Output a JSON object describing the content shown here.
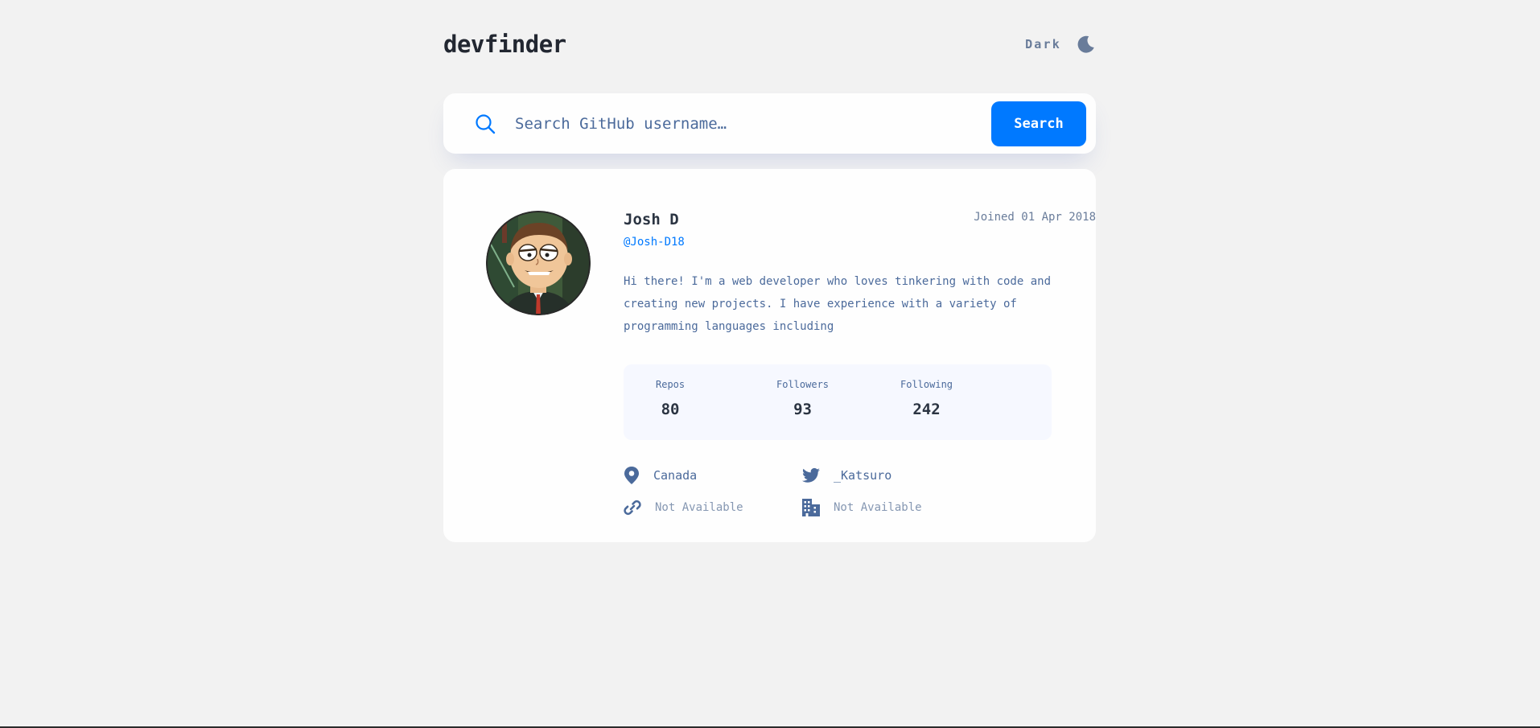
{
  "header": {
    "logo": "devfinder",
    "theme_label": "Dark",
    "theme_icon": "moon-icon"
  },
  "search": {
    "placeholder": "Search GitHub username…",
    "value": "",
    "button_label": "Search",
    "icon": "search-icon"
  },
  "profile": {
    "name": "Josh D",
    "login": "@Josh-D18",
    "joined": "Joined 01 Apr 2018",
    "bio": "Hi there! I'm a web developer who loves tinkering with code and creating new projects. I have experience with a variety of programming languages including",
    "stats": [
      {
        "label": "Repos",
        "value": "80"
      },
      {
        "label": "Followers",
        "value": "93"
      },
      {
        "label": "Following",
        "value": "242"
      }
    ],
    "links": {
      "location": {
        "icon": "location-pin-icon",
        "text": "Canada"
      },
      "twitter": {
        "icon": "twitter-icon",
        "text": "_Katsuro"
      },
      "website": {
        "icon": "link-icon",
        "text": "Not Available"
      },
      "company": {
        "icon": "building-icon",
        "text": "Not Available"
      }
    }
  },
  "colors": {
    "accent": "#0079ff",
    "background": "#f2f2f2",
    "card": "#fefefe",
    "text_dark": "#2b3442",
    "text_muted": "#4b6a9b"
  }
}
